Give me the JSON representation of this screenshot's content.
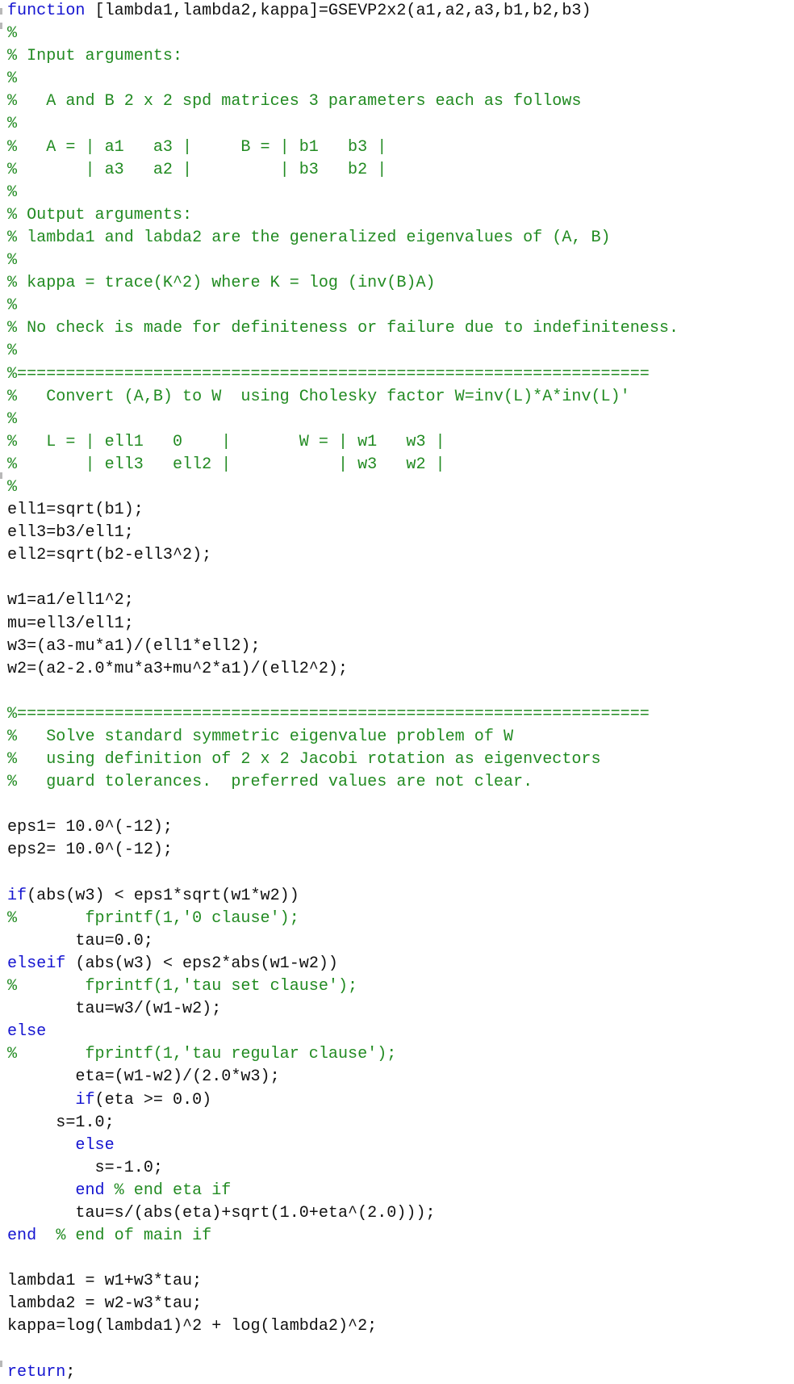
{
  "editor": {
    "language": "matlab",
    "colors": {
      "keyword": "#1414d0",
      "comment": "#228b22",
      "text": "#111111",
      "string": "#a020a0",
      "background": "#ffffff"
    },
    "lines": [
      [
        {
          "t": "kw",
          "v": "function"
        },
        {
          "t": "tx",
          "v": " [lambda1,lambda2,kappa]=GSEVP2x2(a1,a2,a3,b1,b2,b3)"
        }
      ],
      [
        {
          "t": "cm",
          "v": "%"
        }
      ],
      [
        {
          "t": "cm",
          "v": "% Input arguments:"
        }
      ],
      [
        {
          "t": "cm",
          "v": "%"
        }
      ],
      [
        {
          "t": "cm",
          "v": "%   A and B 2 x 2 spd matrices 3 parameters each as follows"
        }
      ],
      [
        {
          "t": "cm",
          "v": "%"
        }
      ],
      [
        {
          "t": "cm",
          "v": "%   A = | a1   a3 |     B = | b1   b3 |"
        }
      ],
      [
        {
          "t": "cm",
          "v": "%       | a3   a2 |         | b3   b2 |"
        }
      ],
      [
        {
          "t": "cm",
          "v": "%"
        }
      ],
      [
        {
          "t": "cm",
          "v": "% Output arguments:"
        }
      ],
      [
        {
          "t": "cm",
          "v": "% lambda1 and labda2 are the generalized eigenvalues of (A, B)"
        }
      ],
      [
        {
          "t": "cm",
          "v": "%"
        }
      ],
      [
        {
          "t": "cm",
          "v": "% kappa = trace(K^2) where K = log (inv(B)A)"
        }
      ],
      [
        {
          "t": "cm",
          "v": "%"
        }
      ],
      [
        {
          "t": "cm",
          "v": "% No check is made for definiteness or failure due to indefiniteness."
        }
      ],
      [
        {
          "t": "cm",
          "v": "%"
        }
      ],
      [
        {
          "t": "cm",
          "v": "%================================================================="
        }
      ],
      [
        {
          "t": "cm",
          "v": "%   Convert (A,B) to W  using Cholesky factor W=inv(L)*A*inv(L)'"
        }
      ],
      [
        {
          "t": "cm",
          "v": "%"
        }
      ],
      [
        {
          "t": "cm",
          "v": "%   L = | ell1   0    |       W = | w1   w3 |"
        }
      ],
      [
        {
          "t": "cm",
          "v": "%       | ell3   ell2 |           | w3   w2 |"
        }
      ],
      [
        {
          "t": "cm",
          "v": "%"
        }
      ],
      [
        {
          "t": "tx",
          "v": "ell1=sqrt(b1);"
        }
      ],
      [
        {
          "t": "tx",
          "v": "ell3=b3/ell1;"
        }
      ],
      [
        {
          "t": "tx",
          "v": "ell2=sqrt(b2-ell3^2);"
        }
      ],
      [
        {
          "t": "tx",
          "v": ""
        }
      ],
      [
        {
          "t": "tx",
          "v": "w1=a1/ell1^2;"
        }
      ],
      [
        {
          "t": "tx",
          "v": "mu=ell3/ell1;"
        }
      ],
      [
        {
          "t": "tx",
          "v": "w3=(a3-mu*a1)/(ell1*ell2);"
        }
      ],
      [
        {
          "t": "tx",
          "v": "w2=(a2-2.0*mu*a3+mu^2*a1)/(ell2^2);"
        }
      ],
      [
        {
          "t": "tx",
          "v": ""
        }
      ],
      [
        {
          "t": "cm",
          "v": "%================================================================="
        }
      ],
      [
        {
          "t": "cm",
          "v": "%   Solve standard symmetric eigenvalue problem of W"
        }
      ],
      [
        {
          "t": "cm",
          "v": "%   using definition of 2 x 2 Jacobi rotation as eigenvectors"
        }
      ],
      [
        {
          "t": "cm",
          "v": "%   guard tolerances.  preferred values are not clear."
        }
      ],
      [
        {
          "t": "tx",
          "v": ""
        }
      ],
      [
        {
          "t": "tx",
          "v": "eps1= 10.0^(-12);"
        }
      ],
      [
        {
          "t": "tx",
          "v": "eps2= 10.0^(-12);"
        }
      ],
      [
        {
          "t": "tx",
          "v": ""
        }
      ],
      [
        {
          "t": "kw",
          "v": "if"
        },
        {
          "t": "tx",
          "v": "(abs(w3) < eps1*sqrt(w1*w2))"
        }
      ],
      [
        {
          "t": "cm",
          "v": "%       fprintf(1,'0 clause');"
        }
      ],
      [
        {
          "t": "tx",
          "v": "       tau=0.0;"
        }
      ],
      [
        {
          "t": "kw",
          "v": "elseif"
        },
        {
          "t": "tx",
          "v": " (abs(w3) < eps2*abs(w1-w2))"
        }
      ],
      [
        {
          "t": "cm",
          "v": "%       fprintf(1,'tau set clause');"
        }
      ],
      [
        {
          "t": "tx",
          "v": "       tau=w3/(w1-w2);"
        }
      ],
      [
        {
          "t": "kw",
          "v": "else"
        }
      ],
      [
        {
          "t": "cm",
          "v": "%       fprintf(1,'tau regular clause');"
        }
      ],
      [
        {
          "t": "tx",
          "v": "       eta=(w1-w2)/(2.0*w3);"
        }
      ],
      [
        {
          "t": "tx",
          "v": "       "
        },
        {
          "t": "kw",
          "v": "if"
        },
        {
          "t": "tx",
          "v": "(eta >= 0.0)"
        }
      ],
      [
        {
          "t": "tx",
          "v": "     s=1.0;"
        }
      ],
      [
        {
          "t": "tx",
          "v": "       "
        },
        {
          "t": "kw",
          "v": "else"
        }
      ],
      [
        {
          "t": "tx",
          "v": "         s=-1.0;"
        }
      ],
      [
        {
          "t": "tx",
          "v": "       "
        },
        {
          "t": "kw",
          "v": "end"
        },
        {
          "t": "tx",
          "v": " "
        },
        {
          "t": "cm",
          "v": "% end eta if"
        }
      ],
      [
        {
          "t": "tx",
          "v": "       tau=s/(abs(eta)+sqrt(1.0+eta^(2.0)));"
        }
      ],
      [
        {
          "t": "kw",
          "v": "end"
        },
        {
          "t": "tx",
          "v": "  "
        },
        {
          "t": "cm",
          "v": "% end of main if"
        }
      ],
      [
        {
          "t": "tx",
          "v": ""
        }
      ],
      [
        {
          "t": "tx",
          "v": "lambda1 = w1+w3*tau;"
        }
      ],
      [
        {
          "t": "tx",
          "v": "lambda2 = w2-w3*tau;"
        }
      ],
      [
        {
          "t": "tx",
          "v": "kappa=log(lambda1)^2 + log(lambda2)^2;"
        }
      ],
      [
        {
          "t": "tx",
          "v": ""
        }
      ],
      [
        {
          "t": "kw",
          "v": "return"
        },
        {
          "t": "tx",
          "v": ";"
        }
      ]
    ]
  }
}
